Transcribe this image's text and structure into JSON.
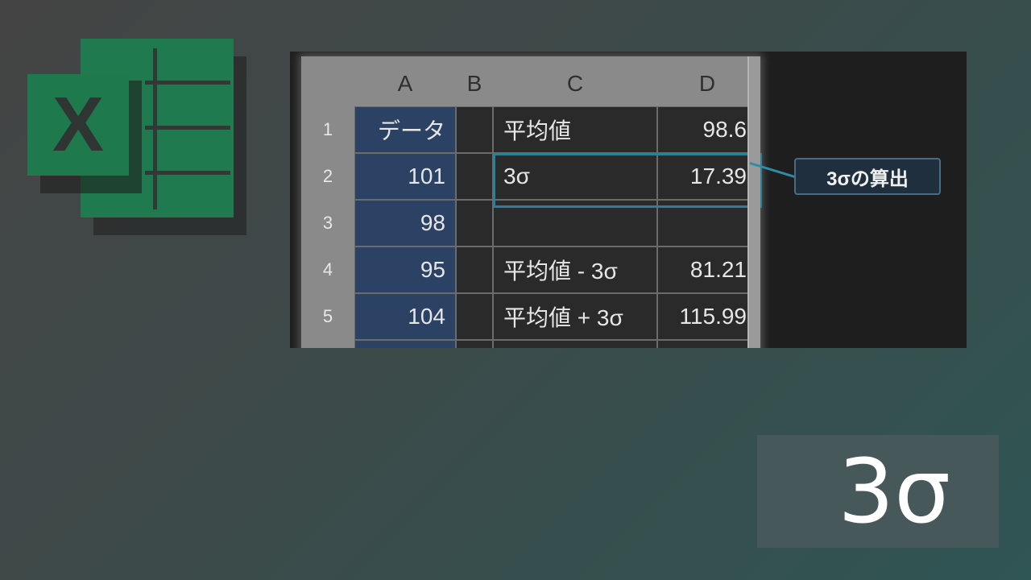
{
  "logo": {
    "letter": "X"
  },
  "sheet": {
    "columns": [
      "A",
      "B",
      "C",
      "D"
    ],
    "rows": [
      {
        "num": "1",
        "a": "データ",
        "c": "平均値",
        "d": "98.6"
      },
      {
        "num": "2",
        "a": "101",
        "c": "3σ",
        "d": "17.39"
      },
      {
        "num": "3",
        "a": "98",
        "c": "",
        "d": ""
      },
      {
        "num": "4",
        "a": "95",
        "c": "平均値 - 3σ",
        "d": "81.21"
      },
      {
        "num": "5",
        "a": "104",
        "c": "平均値 + 3σ",
        "d": "115.99"
      }
    ]
  },
  "callout": {
    "label": "3σの算出"
  },
  "badge": {
    "label": "3σ"
  },
  "colors": {
    "excel_green": "#1f7a4f",
    "column_a_fill": "#2c4264",
    "highlight": "#2e7f96"
  }
}
